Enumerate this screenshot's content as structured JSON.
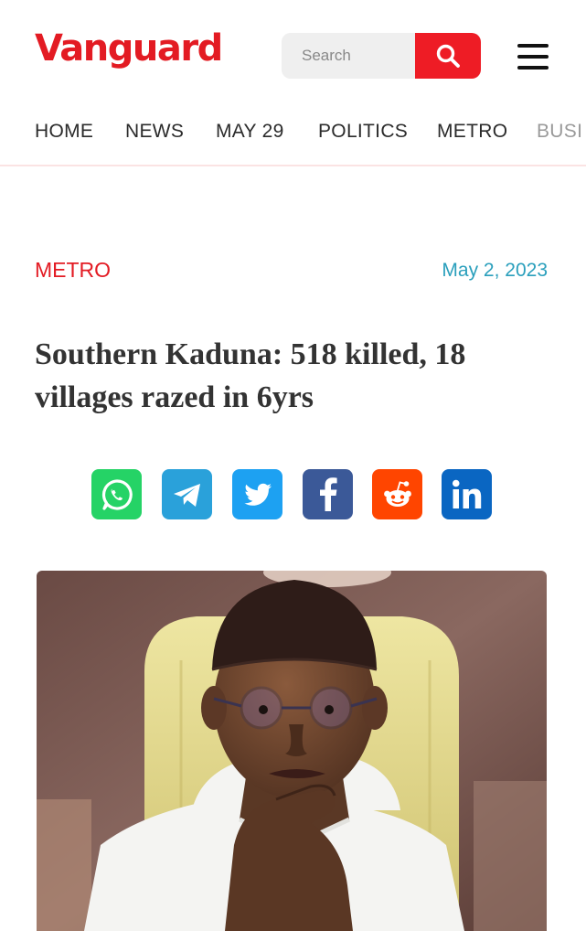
{
  "brand": {
    "name": "Vanguard",
    "color": "#e31b23"
  },
  "search": {
    "placeholder": "Search",
    "icon": "search-icon"
  },
  "menu": {
    "icon": "hamburger-menu-icon"
  },
  "nav": {
    "items": [
      {
        "label": "HOME"
      },
      {
        "label": "NEWS"
      },
      {
        "label": "MAY 29"
      },
      {
        "label": "POLITICS"
      },
      {
        "label": "METRO"
      },
      {
        "label": "BUSI"
      }
    ]
  },
  "article": {
    "category": "METRO",
    "date": "May 2, 2023",
    "headline": "Southern Kaduna: 518 killed, 18 villages razed in 6yrs",
    "share": [
      {
        "network": "WhatsApp",
        "icon": "whatsapp-icon",
        "color": "#25d366"
      },
      {
        "network": "Telegram",
        "icon": "telegram-icon",
        "color": "#2aa1da"
      },
      {
        "network": "Twitter",
        "icon": "twitter-icon",
        "color": "#1da1f2"
      },
      {
        "network": "Facebook",
        "icon": "facebook-icon",
        "color": "#3b5998"
      },
      {
        "network": "Reddit",
        "icon": "reddit-icon",
        "color": "#ff4500"
      },
      {
        "network": "LinkedIn",
        "icon": "linkedin-icon",
        "color": "#0a66c2"
      }
    ]
  },
  "colors": {
    "accent": "#e31b23",
    "date": "#2a9fbc",
    "divider": "#fbe3e3"
  }
}
